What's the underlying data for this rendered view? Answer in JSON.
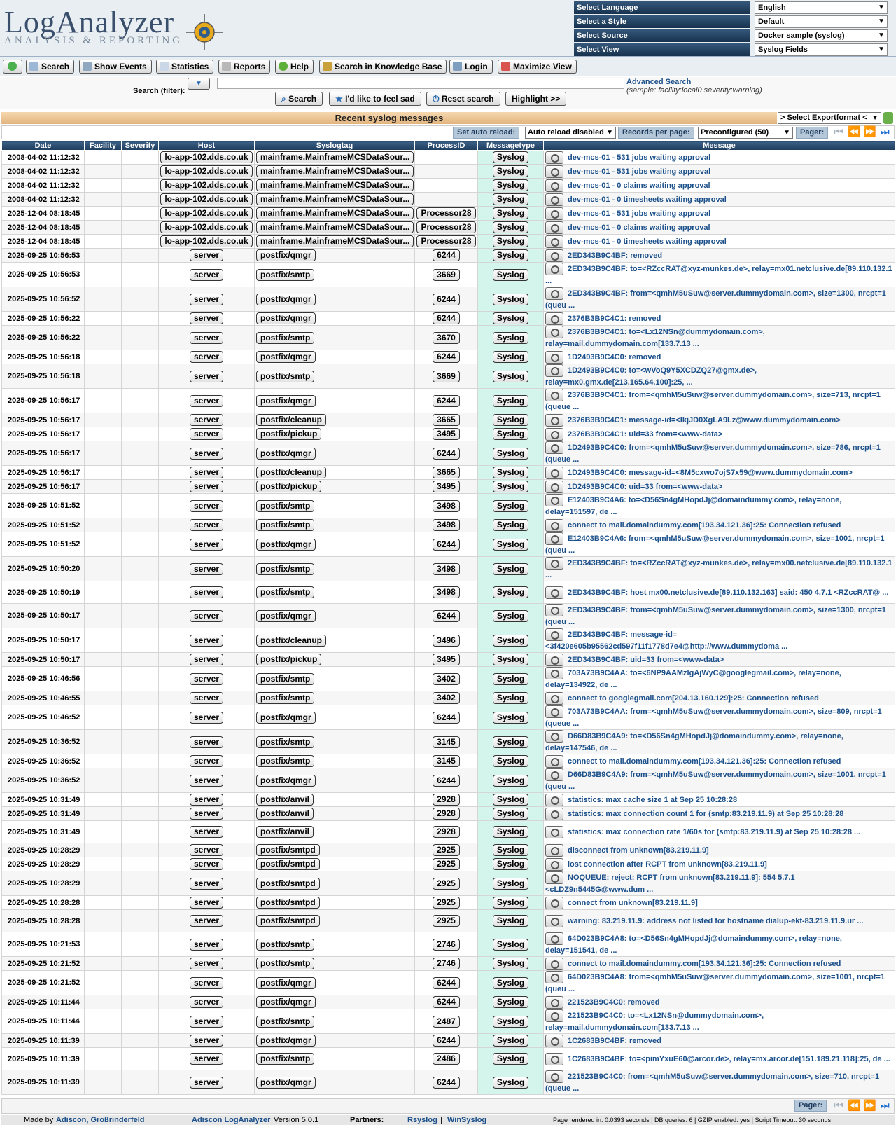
{
  "app": {
    "logo_title": "LogAnalyzer",
    "logo_subtitle": "ANALYSIS & REPORTING"
  },
  "selectors": [
    {
      "label": "Select Language",
      "value": "English"
    },
    {
      "label": "Select a Style",
      "value": "Default"
    },
    {
      "label": "Select Source",
      "value": "Docker sample (syslog)"
    },
    {
      "label": "Select View",
      "value": "Syslog Fields"
    }
  ],
  "nav": {
    "search": "Search",
    "show_events": "Show Events",
    "statistics": "Statistics",
    "reports": "Reports",
    "help": "Help",
    "kb": "Search in Knowledge Base",
    "login": "Login",
    "maximize": "Maximize View"
  },
  "search": {
    "label": "Search (filter):",
    "value": "",
    "advanced": "Advanced Search",
    "sample": "(sample: facility:local0 severity:warning)",
    "search_btn": "Search",
    "sad_btn": "I'd like to feel sad",
    "reset_btn": "Reset search",
    "highlight_btn": "Highlight >>"
  },
  "title": "Recent syslog messages",
  "export": "> Select Exportformat <",
  "toolbar": {
    "auto_reload_label": "Set auto reload:",
    "auto_reload_value": "Auto reload disabled",
    "records_label": "Records per page:",
    "records_value": "Preconfigured (50)",
    "pager_label": "Pager:"
  },
  "columns": [
    "Date",
    "Facility",
    "Severity",
    "Host",
    "Syslogtag",
    "ProcessID",
    "Messagetype",
    "Message"
  ],
  "rows": [
    {
      "date": "2008-04-02 11:12:32",
      "host": "lo-app-102.dds.co.uk",
      "tag": "mainframe.MainframeMCSDataSour...",
      "pid": "",
      "type": "Syslog",
      "msg": "dev-mcs-01 - 531 jobs waiting approval"
    },
    {
      "date": "2008-04-02 11:12:32",
      "host": "lo-app-102.dds.co.uk",
      "tag": "mainframe.MainframeMCSDataSour...",
      "pid": "",
      "type": "Syslog",
      "msg": "dev-mcs-01 - 531 jobs waiting approval"
    },
    {
      "date": "2008-04-02 11:12:32",
      "host": "lo-app-102.dds.co.uk",
      "tag": "mainframe.MainframeMCSDataSour...",
      "pid": "",
      "type": "Syslog",
      "msg": "dev-mcs-01 - 0 claims waiting approval"
    },
    {
      "date": "2008-04-02 11:12:32",
      "host": "lo-app-102.dds.co.uk",
      "tag": "mainframe.MainframeMCSDataSour...",
      "pid": "",
      "type": "Syslog",
      "msg": "dev-mcs-01 - 0 timesheets waiting approval"
    },
    {
      "date": "2025-12-04 08:18:45",
      "host": "lo-app-102.dds.co.uk",
      "tag": "mainframe.MainframeMCSDataSour...",
      "pid": "Processor28",
      "type": "Syslog",
      "msg": "dev-mcs-01 - 531 jobs waiting approval"
    },
    {
      "date": "2025-12-04 08:18:45",
      "host": "lo-app-102.dds.co.uk",
      "tag": "mainframe.MainframeMCSDataSour...",
      "pid": "Processor28",
      "type": "Syslog",
      "msg": "dev-mcs-01 - 0 claims waiting approval"
    },
    {
      "date": "2025-12-04 08:18:45",
      "host": "lo-app-102.dds.co.uk",
      "tag": "mainframe.MainframeMCSDataSour...",
      "pid": "Processor28",
      "type": "Syslog",
      "msg": "dev-mcs-01 - 0 timesheets waiting approval"
    },
    {
      "date": "2025-09-25 10:56:53",
      "host": "server",
      "tag": "postfix/qmgr",
      "pid": "6244",
      "type": "Syslog",
      "msg": "2ED343B9C4BF: removed"
    },
    {
      "date": "2025-09-25 10:56:53",
      "host": "server",
      "tag": "postfix/smtp",
      "pid": "3669",
      "type": "Syslog",
      "msg": "2ED343B9C4BF: to=<RZccRAT@xyz-munkes.de>, relay=mx01.netclusive.de[89.110.132.1 ..."
    },
    {
      "date": "2025-09-25 10:56:52",
      "host": "server",
      "tag": "postfix/qmgr",
      "pid": "6244",
      "type": "Syslog",
      "msg": "2ED343B9C4BF: from=<qmhM5uSuw@server.dummydomain.com>, size=1300, nrcpt=1 (queu ..."
    },
    {
      "date": "2025-09-25 10:56:22",
      "host": "server",
      "tag": "postfix/qmgr",
      "pid": "6244",
      "type": "Syslog",
      "msg": "2376B3B9C4C1: removed"
    },
    {
      "date": "2025-09-25 10:56:22",
      "host": "server",
      "tag": "postfix/smtp",
      "pid": "3670",
      "type": "Syslog",
      "msg": "2376B3B9C4C1: to=<Lx12NSn@dummydomain.com>, relay=mail.dummydomain.com[133.7.13 ..."
    },
    {
      "date": "2025-09-25 10:56:18",
      "host": "server",
      "tag": "postfix/qmgr",
      "pid": "6244",
      "type": "Syslog",
      "msg": "1D2493B9C4C0: removed"
    },
    {
      "date": "2025-09-25 10:56:18",
      "host": "server",
      "tag": "postfix/smtp",
      "pid": "3669",
      "type": "Syslog",
      "msg": "1D2493B9C4C0: to=<wVoQ9Y5XCDZQ27@gmx.de>, relay=mx0.gmx.de[213.165.64.100]:25, ..."
    },
    {
      "date": "2025-09-25 10:56:17",
      "host": "server",
      "tag": "postfix/qmgr",
      "pid": "6244",
      "type": "Syslog",
      "msg": "2376B3B9C4C1: from=<qmhM5uSuw@server.dummydomain.com>, size=713, nrcpt=1 (queue ..."
    },
    {
      "date": "2025-09-25 10:56:17",
      "host": "server",
      "tag": "postfix/cleanup",
      "pid": "3665",
      "type": "Syslog",
      "msg": "2376B3B9C4C1: message-id=<lkjJD0XgLA9Lz@www.dummydomain.com>"
    },
    {
      "date": "2025-09-25 10:56:17",
      "host": "server",
      "tag": "postfix/pickup",
      "pid": "3495",
      "type": "Syslog",
      "msg": "2376B3B9C4C1: uid=33 from=<www-data>"
    },
    {
      "date": "2025-09-25 10:56:17",
      "host": "server",
      "tag": "postfix/qmgr",
      "pid": "6244",
      "type": "Syslog",
      "msg": "1D2493B9C4C0: from=<qmhM5uSuw@server.dummydomain.com>, size=786, nrcpt=1 (queue ..."
    },
    {
      "date": "2025-09-25 10:56:17",
      "host": "server",
      "tag": "postfix/cleanup",
      "pid": "3665",
      "type": "Syslog",
      "msg": "1D2493B9C4C0: message-id=<8M5cxwo7ojS7x59@www.dummydomain.com>"
    },
    {
      "date": "2025-09-25 10:56:17",
      "host": "server",
      "tag": "postfix/pickup",
      "pid": "3495",
      "type": "Syslog",
      "msg": "1D2493B9C4C0: uid=33 from=<www-data>"
    },
    {
      "date": "2025-09-25 10:51:52",
      "host": "server",
      "tag": "postfix/smtp",
      "pid": "3498",
      "type": "Syslog",
      "msg": "E12403B9C4A6: to=<D56Sn4gMHopdJj@domaindummy.com>, relay=none, delay=151597, de ..."
    },
    {
      "date": "2025-09-25 10:51:52",
      "host": "server",
      "tag": "postfix/smtp",
      "pid": "3498",
      "type": "Syslog",
      "msg": "connect to mail.domaindummy.com[193.34.121.36]:25: Connection refused"
    },
    {
      "date": "2025-09-25 10:51:52",
      "host": "server",
      "tag": "postfix/qmgr",
      "pid": "6244",
      "type": "Syslog",
      "msg": "E12403B9C4A6: from=<qmhM5uSuw@server.dummydomain.com>, size=1001, nrcpt=1 (queu ..."
    },
    {
      "date": "2025-09-25 10:50:20",
      "host": "server",
      "tag": "postfix/smtp",
      "pid": "3498",
      "type": "Syslog",
      "msg": "2ED343B9C4BF: to=<RZccRAT@xyz-munkes.de>, relay=mx00.netclusive.de[89.110.132.1 ..."
    },
    {
      "date": "2025-09-25 10:50:19",
      "host": "server",
      "tag": "postfix/smtp",
      "pid": "3498",
      "type": "Syslog",
      "msg": "2ED343B9C4BF: host mx00.netclusive.de[89.110.132.163] said: 450 4.7.1 <RZccRAT@ ..."
    },
    {
      "date": "2025-09-25 10:50:17",
      "host": "server",
      "tag": "postfix/qmgr",
      "pid": "6244",
      "type": "Syslog",
      "msg": "2ED343B9C4BF: from=<qmhM5uSuw@server.dummydomain.com>, size=1300, nrcpt=1 (queu ..."
    },
    {
      "date": "2025-09-25 10:50:17",
      "host": "server",
      "tag": "postfix/cleanup",
      "pid": "3496",
      "type": "Syslog",
      "msg": "2ED343B9C4BF: message-id=<3f420e605b95562cd597f11f1778d7e4@http://www.dummydoma ..."
    },
    {
      "date": "2025-09-25 10:50:17",
      "host": "server",
      "tag": "postfix/pickup",
      "pid": "3495",
      "type": "Syslog",
      "msg": "2ED343B9C4BF: uid=33 from=<www-data>"
    },
    {
      "date": "2025-09-25 10:46:56",
      "host": "server",
      "tag": "postfix/smtp",
      "pid": "3402",
      "type": "Syslog",
      "msg": "703A73B9C4AA: to=<6NP9AAMzlgAjWyC@googlegmail.com>, relay=none, delay=134922, de ..."
    },
    {
      "date": "2025-09-25 10:46:55",
      "host": "server",
      "tag": "postfix/smtp",
      "pid": "3402",
      "type": "Syslog",
      "msg": "connect to googlegmail.com[204.13.160.129]:25: Connection refused"
    },
    {
      "date": "2025-09-25 10:46:52",
      "host": "server",
      "tag": "postfix/qmgr",
      "pid": "6244",
      "type": "Syslog",
      "msg": "703A73B9C4AA: from=<qmhM5uSuw@server.dummydomain.com>, size=809, nrcpt=1 (queue ..."
    },
    {
      "date": "2025-09-25 10:36:52",
      "host": "server",
      "tag": "postfix/smtp",
      "pid": "3145",
      "type": "Syslog",
      "msg": "D66D83B9C4A9: to=<D56Sn4gMHopdJj@domaindummy.com>, relay=none, delay=147546, de ..."
    },
    {
      "date": "2025-09-25 10:36:52",
      "host": "server",
      "tag": "postfix/smtp",
      "pid": "3145",
      "type": "Syslog",
      "msg": "connect to mail.domaindummy.com[193.34.121.36]:25: Connection refused"
    },
    {
      "date": "2025-09-25 10:36:52",
      "host": "server",
      "tag": "postfix/qmgr",
      "pid": "6244",
      "type": "Syslog",
      "msg": "D66D83B9C4A9: from=<qmhM5uSuw@server.dummydomain.com>, size=1001, nrcpt=1 (queu ..."
    },
    {
      "date": "2025-09-25 10:31:49",
      "host": "server",
      "tag": "postfix/anvil",
      "pid": "2928",
      "type": "Syslog",
      "msg": "statistics: max cache size 1 at Sep 25 10:28:28"
    },
    {
      "date": "2025-09-25 10:31:49",
      "host": "server",
      "tag": "postfix/anvil",
      "pid": "2928",
      "type": "Syslog",
      "msg": "statistics: max connection count 1 for (smtp:83.219.11.9) at Sep 25 10:28:28"
    },
    {
      "date": "2025-09-25 10:31:49",
      "host": "server",
      "tag": "postfix/anvil",
      "pid": "2928",
      "type": "Syslog",
      "msg": "statistics: max connection rate 1/60s for (smtp:83.219.11.9) at Sep 25 10:28:28 ..."
    },
    {
      "date": "2025-09-25 10:28:29",
      "host": "server",
      "tag": "postfix/smtpd",
      "pid": "2925",
      "type": "Syslog",
      "msg": "disconnect from unknown[83.219.11.9]"
    },
    {
      "date": "2025-09-25 10:28:29",
      "host": "server",
      "tag": "postfix/smtpd",
      "pid": "2925",
      "type": "Syslog",
      "msg": "lost connection after RCPT from unknown[83.219.11.9]"
    },
    {
      "date": "2025-09-25 10:28:29",
      "host": "server",
      "tag": "postfix/smtpd",
      "pid": "2925",
      "type": "Syslog",
      "msg": "NOQUEUE: reject: RCPT from unknown[83.219.11.9]: 554 5.7.1 <cLDZ9n5445G@www.dum ..."
    },
    {
      "date": "2025-09-25 10:28:28",
      "host": "server",
      "tag": "postfix/smtpd",
      "pid": "2925",
      "type": "Syslog",
      "msg": "connect from unknown[83.219.11.9]"
    },
    {
      "date": "2025-09-25 10:28:28",
      "host": "server",
      "tag": "postfix/smtpd",
      "pid": "2925",
      "type": "Syslog",
      "msg": "warning: 83.219.11.9: address not listed for hostname dialup-ekt-83.219.11.9.ur ..."
    },
    {
      "date": "2025-09-25 10:21:53",
      "host": "server",
      "tag": "postfix/smtp",
      "pid": "2746",
      "type": "Syslog",
      "msg": "64D023B9C4A8: to=<D56Sn4gMHopdJj@domaindummy.com>, relay=none, delay=151541, de ..."
    },
    {
      "date": "2025-09-25 10:21:52",
      "host": "server",
      "tag": "postfix/smtp",
      "pid": "2746",
      "type": "Syslog",
      "msg": "connect to mail.domaindummy.com[193.34.121.36]:25: Connection refused"
    },
    {
      "date": "2025-09-25 10:21:52",
      "host": "server",
      "tag": "postfix/qmgr",
      "pid": "6244",
      "type": "Syslog",
      "msg": "64D023B9C4A8: from=<qmhM5uSuw@server.dummydomain.com>, size=1001, nrcpt=1 (queu ..."
    },
    {
      "date": "2025-09-25 10:11:44",
      "host": "server",
      "tag": "postfix/qmgr",
      "pid": "6244",
      "type": "Syslog",
      "msg": "221523B9C4C0: removed"
    },
    {
      "date": "2025-09-25 10:11:44",
      "host": "server",
      "tag": "postfix/smtp",
      "pid": "2487",
      "type": "Syslog",
      "msg": "221523B9C4C0: to=<Lx12NSn@dummydomain.com>, relay=mail.dummydomain.com[133.7.13 ..."
    },
    {
      "date": "2025-09-25 10:11:39",
      "host": "server",
      "tag": "postfix/qmgr",
      "pid": "6244",
      "type": "Syslog",
      "msg": "1C2683B9C4BF: removed"
    },
    {
      "date": "2025-09-25 10:11:39",
      "host": "server",
      "tag": "postfix/smtp",
      "pid": "2486",
      "type": "Syslog",
      "msg": "1C2683B9C4BF: to=<pimYxuE60@arcor.de>, relay=mx.arcor.de[151.189.21.118]:25, de ..."
    },
    {
      "date": "2025-09-25 10:11:39",
      "host": "server",
      "tag": "postfix/qmgr",
      "pid": "6244",
      "type": "Syslog",
      "msg": "221523B9C4C0: from=<qmhM5uSuw@server.dummydomain.com>, size=710, nrcpt=1 (queue ..."
    }
  ],
  "footer": {
    "made_by": "Made by",
    "adiscon": "Adiscon, Großrinderfeld",
    "product": "Adiscon LogAnalyzer",
    "version": "Version 5.0.1",
    "partners": "Partners:",
    "rsyslog": "Rsyslog",
    "sep": "|",
    "winsyslog": "WinSyslog",
    "stats": "Page rendered in: 0.0393 seconds | DB queries: 6 | GZIP enabled: yes | Script Timeout: 30 seconds"
  },
  "colors": {
    "header_bg": "#E9EEF3",
    "accent": "#1E3C5E",
    "link": "#1A4F8A",
    "messagetype_bg": "#D3F5EC"
  }
}
